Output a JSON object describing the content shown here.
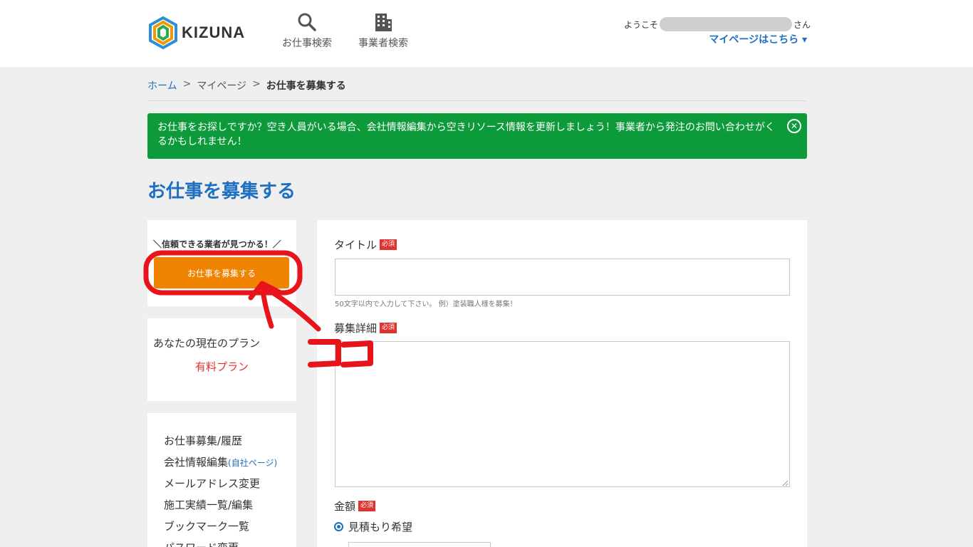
{
  "header": {
    "logo_text": "KIZUNA",
    "nav_search": "お仕事検索",
    "nav_company": "事業者検索",
    "welcome_prefix": "ようこそ",
    "welcome_suffix": "さん",
    "mypage_link": "マイページはこちら ▾"
  },
  "breadcrumb": {
    "home": "ホーム",
    "sep": ">",
    "mypage": "マイページ",
    "current": "お仕事を募集する"
  },
  "notice": {
    "text": "お仕事をお探しですか？空き人員がいる場合、会社情報編集から空きリソース情報を更新しましょう！事業者から発注のお問い合わせがくるかもしれません！",
    "close_icon": "close-circle-icon"
  },
  "page_title": "お仕事を募集する",
  "sidebar": {
    "tagline": "＼信頼できる業者が見つかる！／",
    "cta_label": "お仕事を募集する",
    "plan_label": "あなたの現在のプラン",
    "plan_value": "有料プラン",
    "menu": [
      {
        "label": "お仕事募集/履歴",
        "sub": ""
      },
      {
        "label": "会社情報編集",
        "sub": "(自社ページ)"
      },
      {
        "label": "メールアドレス変更",
        "sub": ""
      },
      {
        "label": "施工実績一覧/編集",
        "sub": ""
      },
      {
        "label": "ブックマーク一覧",
        "sub": ""
      },
      {
        "label": "パスワード変更",
        "sub": ""
      }
    ]
  },
  "form": {
    "title_label": "タイトル",
    "required_badge": "必須",
    "title_value": "",
    "title_hint": "50文字以内で入力して下さい。 例）塗装職人様を募集！",
    "detail_label": "募集詳細",
    "detail_value": "",
    "price_label": "金額",
    "price_option": "見積もり希望"
  },
  "annotation": {
    "text": "ココ",
    "color": "#e8141c"
  },
  "colors": {
    "accent_blue": "#1e6fbf",
    "notice_green": "#0d9a3a",
    "cta_orange": "#f08300",
    "required_red": "#e0322e"
  }
}
